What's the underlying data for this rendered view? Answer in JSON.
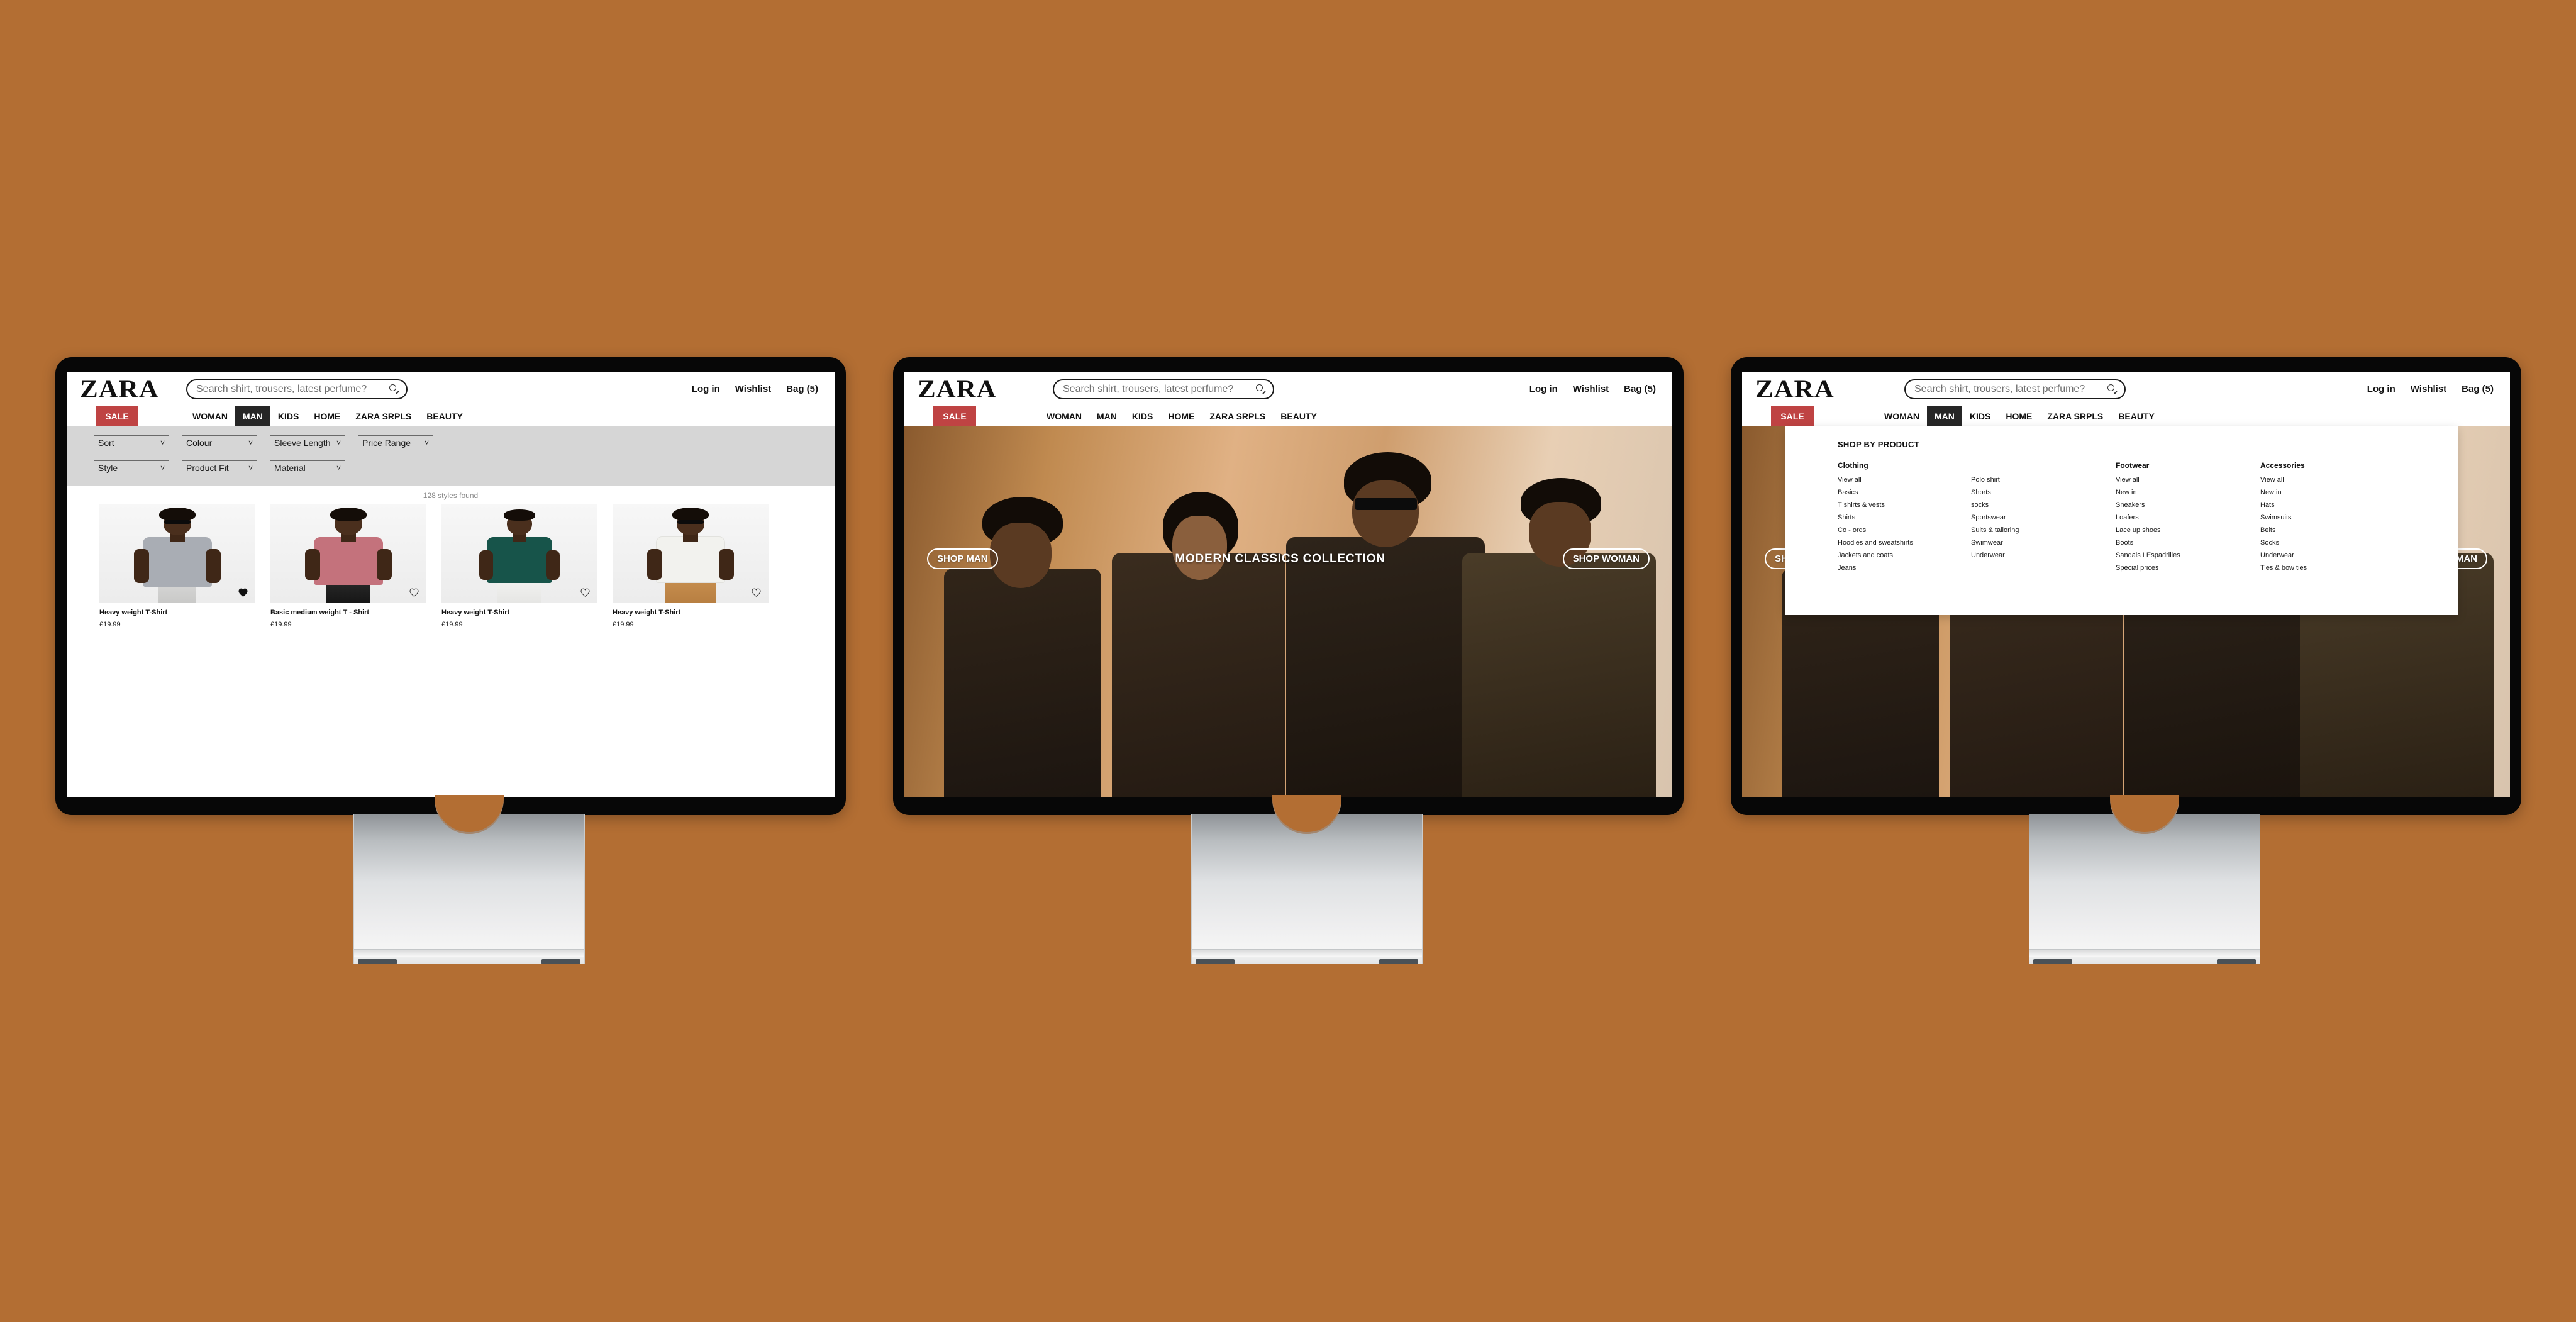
{
  "page": {
    "background_color": "#b36e33",
    "monitor_count": 3
  },
  "brand": {
    "logo_text": "ZARA",
    "sale_label": "SALE",
    "sale_color": "#bf4343",
    "accent_dark": "#262626"
  },
  "header": {
    "search_placeholder": "Search shirt, trousers, latest perfume?",
    "search_icon": "search-icon",
    "actions": [
      {
        "label": "Log in"
      },
      {
        "label": "Wishlist"
      },
      {
        "label": "Bag (5)"
      }
    ]
  },
  "nav": {
    "items": [
      {
        "label": "WOMAN",
        "active": false
      },
      {
        "label": "MAN",
        "active": true
      },
      {
        "label": "KIDS",
        "active": false
      },
      {
        "label": "HOME",
        "active": false
      },
      {
        "label": "ZARA SRPLS",
        "active": false
      },
      {
        "label": "BEAUTY",
        "active": false
      }
    ]
  },
  "screen1": {
    "filters_row1": [
      {
        "label": "Sort"
      },
      {
        "label": "Colour"
      },
      {
        "label": "Sleeve Length"
      },
      {
        "label": "Price Range"
      }
    ],
    "filters_row2": [
      {
        "label": "Style"
      },
      {
        "label": "Product Fit"
      },
      {
        "label": "Material"
      }
    ],
    "results_count": "128 styles found",
    "products": [
      {
        "name": "Heavy weight T-Shirt",
        "price": "£19.99",
        "favourited": true,
        "shirt_color": "#a9adb4"
      },
      {
        "name": "Basic medium weight T - Shirt",
        "price": "£19.99",
        "favourited": false,
        "shirt_color": "#c4727c"
      },
      {
        "name": "Heavy weight T-Shirt",
        "price": "£19.99",
        "favourited": false,
        "shirt_color": "#17544a"
      },
      {
        "name": "Heavy weight T-Shirt",
        "price": "£19.99",
        "favourited": false,
        "shirt_color": "#f2f2ee"
      }
    ]
  },
  "hero": {
    "shop_man_label": "SHOP MAN",
    "title": "MODERN CLASSICS COLLECTION",
    "shop_woman_label": "SHOP WOMAN"
  },
  "megamenu": {
    "title": "SHOP BY PRODUCT",
    "columns": [
      {
        "heading": "Clothing",
        "items": [
          "View all",
          "Basics",
          "T shirts & vests",
          "Shirts",
          "Co - ords",
          "Hoodies and sweatshirts",
          "Jackets and coats",
          "Jeans"
        ]
      },
      {
        "heading": "",
        "items": [
          "Polo shirt",
          "Shorts",
          "socks",
          "Sportswear",
          "Suits & tailoring",
          "Swimwear",
          "Underwear"
        ]
      },
      {
        "heading": "Footwear",
        "items": [
          "View all",
          "New in",
          "Sneakers",
          "Loafers",
          "Lace up shoes",
          "Boots",
          "Sandals I Espadrilles",
          "Special prices"
        ]
      },
      {
        "heading": "Accessories",
        "items": [
          "View all",
          "New in",
          "Hats",
          "Swimsuits",
          "Belts",
          "Socks",
          "Underwear",
          "Ties & bow ties"
        ]
      }
    ]
  }
}
